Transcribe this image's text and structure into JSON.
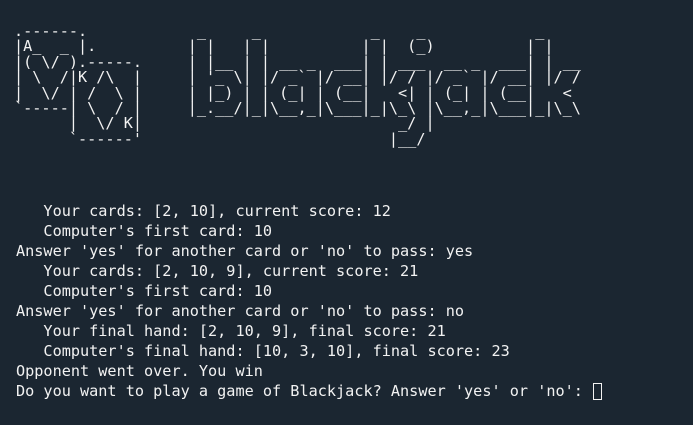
{
  "terminal": {
    "banner_art": ".------.            _     _            _    _            _\n|A_  _ |.          | |   | |          | |  (_)          | |\n|( \\/ ).-----.     | |__ | | __ _  ___| | ___  __ _  ___| | __\n| \\  /|K /\\  |     | '_ \\| |/ _` |/ __| |/ / |/ _` |/ __| |/ /\n|  \\/ | /  \\ |     | |_) | | (_| | (__|   <| | (_| | (__|   <\n`-----| \\  / |     |_.__/|_|\\__,_|\\___|_|\\_\\ |\\__,_|\\___|_|\\_\\\n      |  \\/ K|                            _/ |\n      `------'                           |__/",
    "lines": [
      "   Your cards: [2, 10], current score: 12",
      "   Computer's first card: 10",
      "Answer 'yes' for another card or 'no' to pass: yes",
      "   Your cards: [2, 10, 9], current score: 21",
      "   Computer's first card: 10",
      "Answer 'yes' for another card or 'no' to pass: no",
      "   Your final hand: [2, 10, 9], final score: 21",
      "   Computer's final hand: [10, 3, 10], final score: 23",
      "Opponent went over. You win"
    ],
    "prompt": "Do you want to play a game of Blackjack? Answer 'yes' or 'no': ",
    "colors": {
      "background": "#1b2631",
      "foreground": "#f2f2f2"
    }
  }
}
